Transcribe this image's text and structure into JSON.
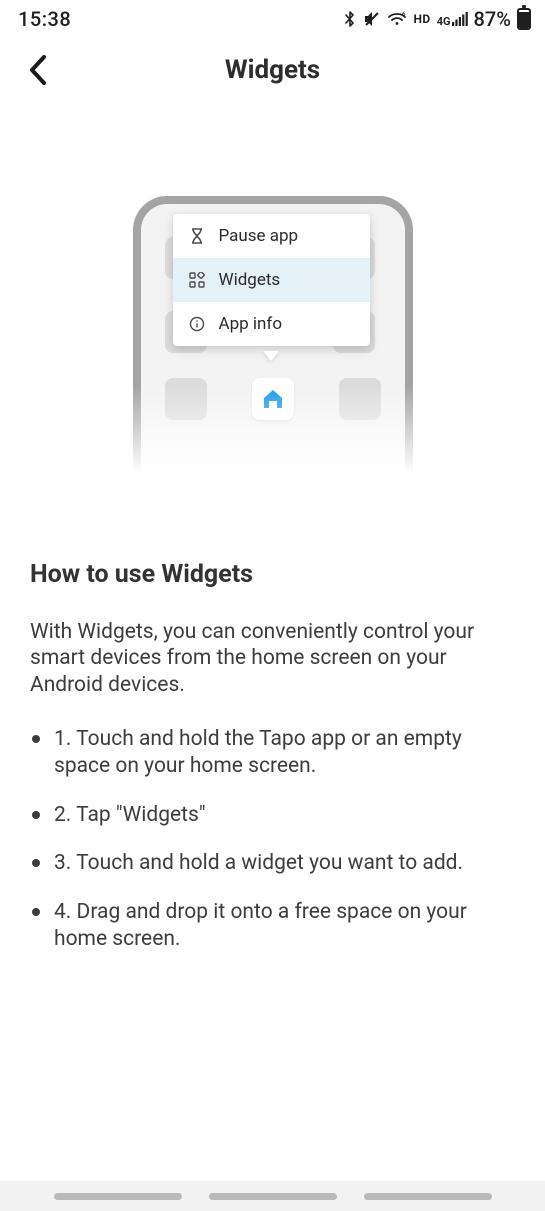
{
  "status": {
    "time": "15:38",
    "hd": "HD",
    "fourg": "4G",
    "battery_pct": "87%"
  },
  "header": {
    "title": "Widgets"
  },
  "illustration": {
    "menu": {
      "pause": "Pause app",
      "widgets": "Widgets",
      "info": "App info"
    }
  },
  "article": {
    "heading": "How to use Widgets",
    "lead": "With Widgets, you can conveniently control your smart devices from the home screen on your Android devices.",
    "steps": [
      "1. Touch and hold the Tapo app or an empty space on your home screen.",
      "2. Tap \"Widgets\"",
      "3. Touch and hold a widget you want to add.",
      "4. Drag and drop it onto a free space on your home screen."
    ]
  }
}
